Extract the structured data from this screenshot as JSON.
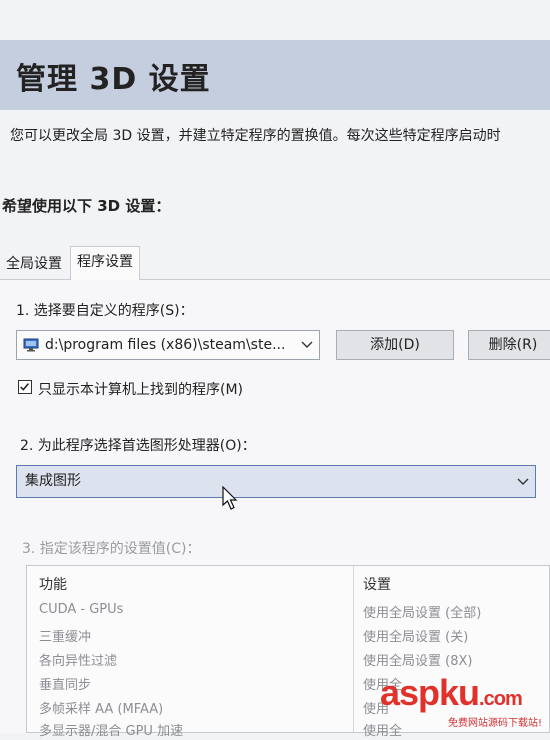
{
  "header": {
    "title": "管理 3D 设置"
  },
  "description": "您可以更改全局 3D 设置，并建立特定程序的置换值。每次这些特定程序启动时",
  "section_title": "希望使用以下 3D 设置：",
  "tabs": [
    {
      "label": "全局设置",
      "active": false
    },
    {
      "label": "程序设置",
      "active": true
    }
  ],
  "step1": {
    "label": "1. 选择要自定义的程序(S)：",
    "program_value": "d:\\program files (x86)\\steam\\ste...",
    "add_label": "添加(D)",
    "delete_label": "删除(R)"
  },
  "checkbox": {
    "label": "只显示本计算机上找到的程序(M)",
    "checked": true
  },
  "step2": {
    "label": "2. 为此程序选择首选图形处理器(O)：",
    "selected": "集成图形"
  },
  "step3": {
    "label": "3. 指定该程序的设置值(C)：",
    "columns": [
      "功能",
      "设置"
    ],
    "rows": [
      [
        "CUDA - GPUs",
        "使用全局设置 (全部)"
      ],
      [
        "三重缓冲",
        "使用全局设置 (关)"
      ],
      [
        "各向异性过滤",
        "使用全局设置 (8X)"
      ],
      [
        "垂直同步",
        "使用全"
      ],
      [
        "多帧采样 AA (MFAA)",
        "使用"
      ],
      [
        "多显示器/混合 GPU 加速",
        "使用全"
      ]
    ]
  },
  "watermark": {
    "brand": "aspku",
    "brand_suffix": ".com",
    "tagline": "免费网站源码下载站!"
  },
  "colors": {
    "header_bg": "#c4cede",
    "select_border": "#5a7ab0",
    "watermark_red": "#e0312b"
  },
  "icons": {
    "program": "monitor-icon",
    "dropdown": "chevron-down-icon",
    "cursor": "mouse-pointer-icon"
  }
}
